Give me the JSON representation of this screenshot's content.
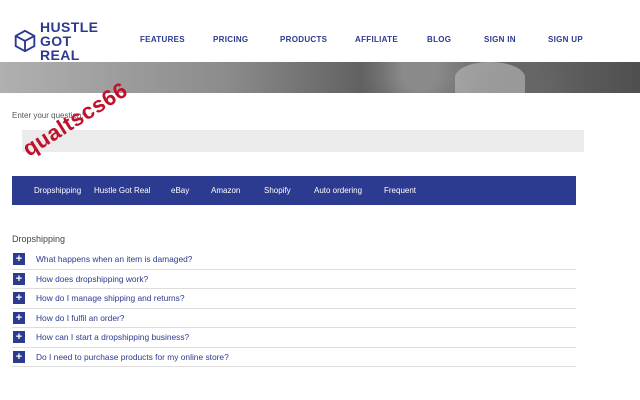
{
  "brand": {
    "line1": "HUSTLE",
    "line2": "GOT REAL"
  },
  "nav": [
    "FEATURES",
    "PRICING",
    "PRODUCTS",
    "AFFILIATE",
    "BLOG",
    "SIGN IN",
    "SIGN UP"
  ],
  "question": {
    "label": "Enter your question:",
    "placeholder": "· · · ·"
  },
  "tabs": [
    "Dropshipping",
    "Hustle Got Real",
    "eBay",
    "Amazon",
    "Shopify",
    "Auto ordering",
    "Frequent"
  ],
  "watermark": "qualtscs66",
  "section": {
    "title": "Dropshipping",
    "items": [
      "What happens when an item is damaged?",
      "How does dropshipping work?",
      "How do I manage shipping and returns?",
      "How do I fulfil an order?",
      "How can I start a dropshipping business?",
      "Do I need to purchase products for my online store?"
    ]
  },
  "colors": {
    "brand": "#2c3a8f",
    "watermark": "#c0102a"
  }
}
